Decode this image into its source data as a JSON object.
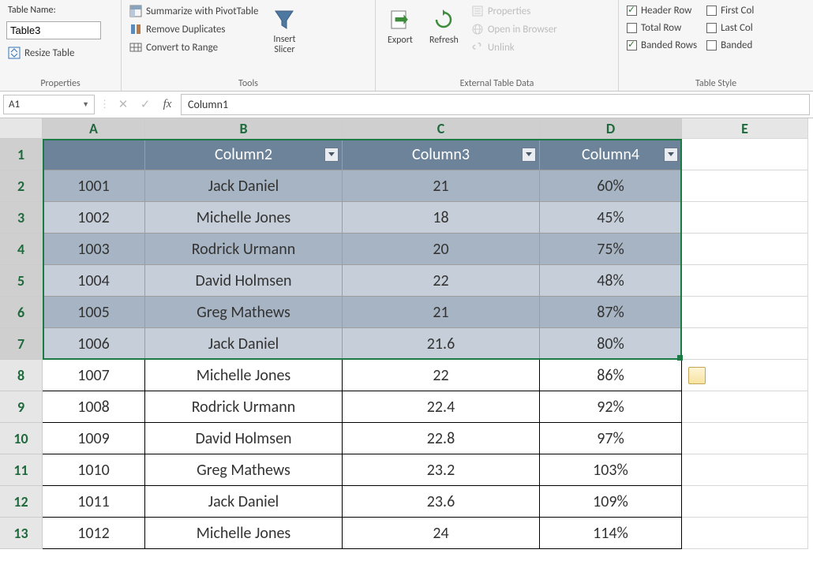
{
  "ribbon": {
    "table_name_label": "Table Name:",
    "table_name_value": "Table3",
    "resize_table": "Resize Table",
    "group_properties": "Properties",
    "pivot": "Summarize with PivotTable",
    "remove_dup": "Remove Duplicates",
    "convert_range": "Convert to Range",
    "insert_slicer": "Insert Slicer",
    "group_tools": "Tools",
    "export": "Export",
    "refresh": "Refresh",
    "ext_properties": "Properties",
    "open_browser": "Open in Browser",
    "unlink": "Unlink",
    "group_external": "External Table Data",
    "header_row": "Header Row",
    "total_row": "Total Row",
    "banded_rows": "Banded Rows",
    "first_col": "First Col",
    "last_col": "Last Col",
    "banded_col": "Banded",
    "group_table_style": "Table Style"
  },
  "formula_bar": {
    "name_box": "A1",
    "formula_value": "Column1"
  },
  "columns": [
    "A",
    "B",
    "C",
    "D",
    "E"
  ],
  "headers": {
    "c1": "Column1",
    "c2": "Column2",
    "c3": "Column3",
    "c4": "Column4"
  },
  "rows": [
    {
      "n": "1"
    },
    {
      "n": "2",
      "c1": "1001",
      "c2": "Jack Daniel",
      "c3": "21",
      "c4": "60%"
    },
    {
      "n": "3",
      "c1": "1002",
      "c2": "Michelle Jones",
      "c3": "18",
      "c4": "45%"
    },
    {
      "n": "4",
      "c1": "1003",
      "c2": "Rodrick Urmann",
      "c3": "20",
      "c4": "75%"
    },
    {
      "n": "5",
      "c1": "1004",
      "c2": "David Holmsen",
      "c3": "22",
      "c4": "48%"
    },
    {
      "n": "6",
      "c1": "1005",
      "c2": "Greg Mathews",
      "c3": "21",
      "c4": "87%"
    },
    {
      "n": "7",
      "c1": "1006",
      "c2": "Jack Daniel",
      "c3": "21.6",
      "c4": "80%"
    },
    {
      "n": "8",
      "c1": "1007",
      "c2": "Michelle Jones",
      "c3": "22",
      "c4": "86%"
    },
    {
      "n": "9",
      "c1": "1008",
      "c2": "Rodrick Urmann",
      "c3": "22.4",
      "c4": "92%"
    },
    {
      "n": "10",
      "c1": "1009",
      "c2": "David Holmsen",
      "c3": "22.8",
      "c4": "97%"
    },
    {
      "n": "11",
      "c1": "1010",
      "c2": "Greg Mathews",
      "c3": "23.2",
      "c4": "103%"
    },
    {
      "n": "12",
      "c1": "1011",
      "c2": "Jack Daniel",
      "c3": "23.6",
      "c4": "109%"
    },
    {
      "n": "13",
      "c1": "1012",
      "c2": "Michelle Jones",
      "c3": "24",
      "c4": "114%"
    }
  ],
  "selection": {
    "active_cell": "A1",
    "range": "A1:D7"
  }
}
